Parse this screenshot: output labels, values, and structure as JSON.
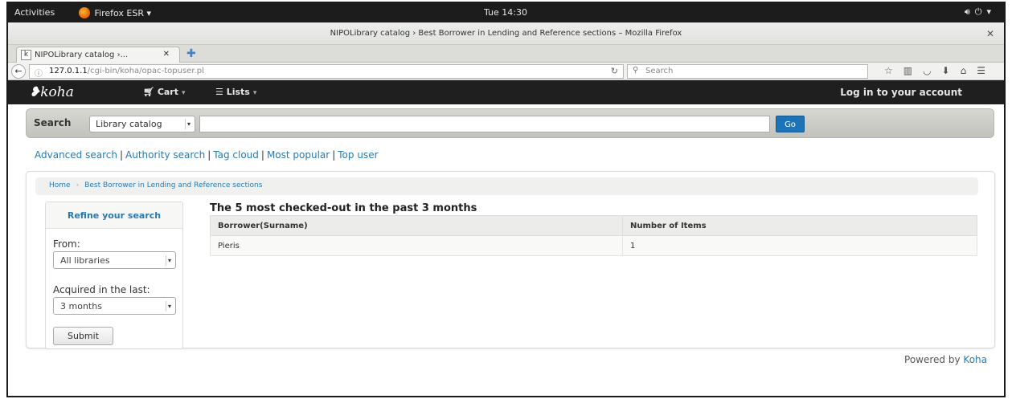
{
  "os_bar": {
    "activities": "Activities",
    "app_name": "Firefox ESR ▾",
    "clock": "Tue 14:30",
    "tray_icons": [
      "volume-icon",
      "power-icon",
      "menu-caret-icon"
    ]
  },
  "window": {
    "title": "NIPOLibrary catalog › Best Borrower in Lending and Reference sections – Mozilla Firefox"
  },
  "tabs": [
    {
      "label": "NIPOLibrary catalog ›...",
      "favicon": "k"
    }
  ],
  "navbar": {
    "url_host": "127.0.1.1",
    "url_path": "/cgi-bin/koha/opac-topuser.pl",
    "search_placeholder": "Search"
  },
  "koha_nav": {
    "logo": "koha",
    "cart_label": "Cart",
    "lists_label": "Lists",
    "login_label": "Log in to your account"
  },
  "search": {
    "label": "Search",
    "scope_selected": "Library catalog",
    "query": "",
    "go_label": "Go"
  },
  "more_searches": [
    "Advanced search",
    "Authority search",
    "Tag cloud",
    "Most popular",
    "Top user"
  ],
  "breadcrumb": [
    "Home",
    "Best Borrower in Lending and Reference sections"
  ],
  "refine": {
    "heading": "Refine your search",
    "from_label": "From:",
    "from_selected": "All libraries",
    "acquired_label": "Acquired in the last:",
    "acquired_selected": "3 months",
    "submit_label": "Submit"
  },
  "results": {
    "title": "The 5 most checked-out in the past 3 months",
    "columns": [
      "Borrower(Surname)",
      "Number of Items"
    ],
    "rows": [
      [
        "Pieris",
        "1"
      ]
    ]
  },
  "footer": {
    "powered_prefix": "Powered by",
    "powered_link": "Koha"
  },
  "colors": {
    "link": "#2a7ab0",
    "go_button": "#1d73b8",
    "koha_bar": "#1f1f1f"
  }
}
